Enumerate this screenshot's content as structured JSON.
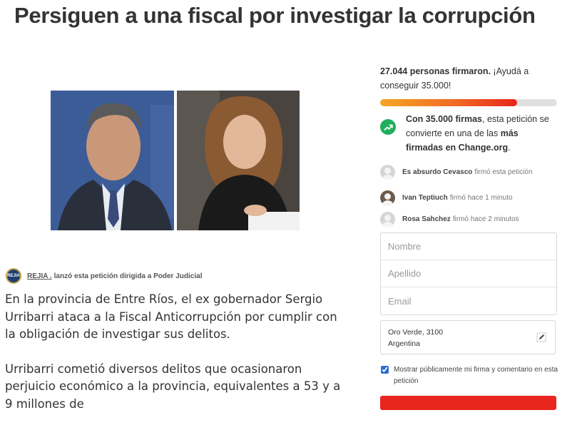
{
  "page": {
    "title": "Persiguen a una fiscal por investigar la corrupción"
  },
  "starter": {
    "logo_text": "REJIA",
    "name": "REJIA .",
    "action": "lanzó esta petición dirigida a Poder Judicial"
  },
  "body": {
    "paragraphs": [
      "En la provincia de Entre Ríos, el ex gobernador Sergio Urribarri ataca a la Fiscal Anticorrupción por cumplir con la obligación de investigar sus delitos.",
      "Urribarri cometió diversos delitos que ocasionaron perjuicio económico a la provincia, equivalentes a 53 y a 9 millones de"
    ]
  },
  "sidebar": {
    "count_bold": "27.044 personas firmaron.",
    "count_rest": " ¡Ayudá a conseguir 35.000!",
    "progress_fraction": 0.7727,
    "goal": {
      "bold1": "Con 35.000 firmas",
      "text1": ", esta petición se convierte en una de las ",
      "bold2": "más firmadas en Change.org",
      "text2": "."
    },
    "signers": [
      {
        "name": "Es absurdo Cevasco",
        "action": "firmó esta petición"
      },
      {
        "name": "Ivan Teptiuch",
        "action": "firmó hace 1 minuto"
      },
      {
        "name": "Rosa Sahchez",
        "action": "firmó hace 2 minutos"
      }
    ]
  },
  "form": {
    "nombre_placeholder": "Nombre",
    "apellido_placeholder": "Apellido",
    "email_placeholder": "Email",
    "location_line1": "Oro Verde, 3100",
    "location_line2": "Argentina",
    "consent_label": "Mostrar públicamente mi firma y comentario en esta petición",
    "consent_checked": true
  },
  "colors": {
    "progress_start": "#f5a623",
    "progress_end": "#e8261d",
    "goal_icon": "#1fae5b",
    "sign_button": "#e8261d"
  }
}
